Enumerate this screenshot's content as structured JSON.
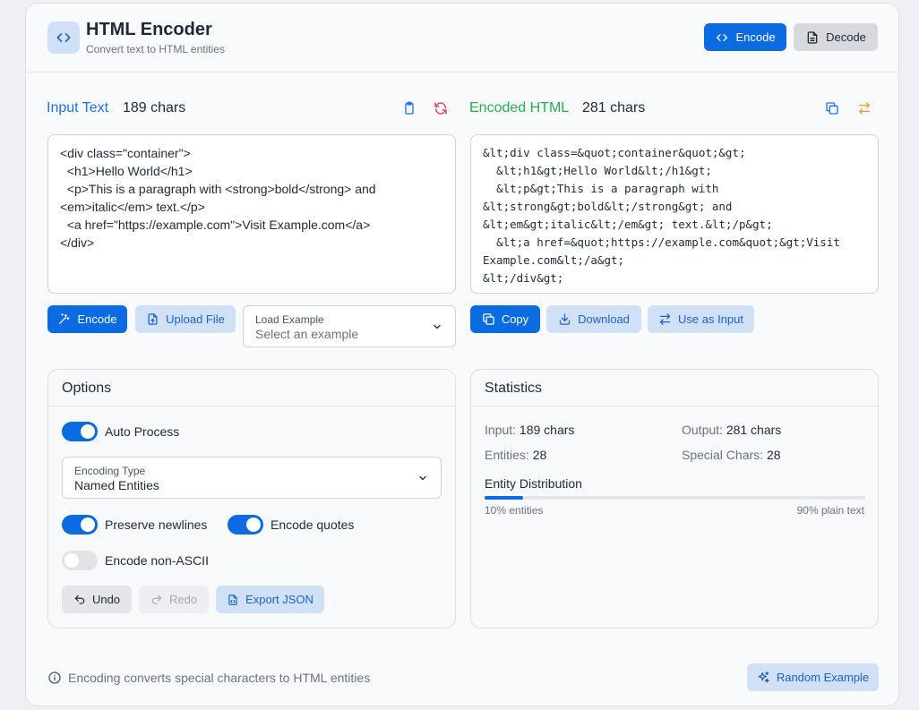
{
  "header": {
    "title": "HTML Encoder",
    "subtitle": "Convert text to HTML entities",
    "encode_label": "Encode",
    "decode_label": "Decode"
  },
  "input": {
    "label": "Input Text",
    "count": "189 chars",
    "text": "<div class=\"container\">\n  <h1>Hello World</h1>\n  <p>This is a paragraph with <strong>bold</strong> and <em>italic</em> text.</p>\n  <a href=\"https://example.com\">Visit Example.com</a>\n</div>",
    "encode_label": "Encode",
    "upload_label": "Upload File",
    "example_select": {
      "label": "Load Example",
      "value": "Select an example"
    }
  },
  "output": {
    "label": "Encoded HTML",
    "count": "281 chars",
    "text": "&lt;div class=&quot;container&quot;&gt;\n  &lt;h1&gt;Hello World&lt;/h1&gt;\n  &lt;p&gt;This is a paragraph with &lt;strong&gt;bold&lt;/strong&gt; and &lt;em&gt;italic&lt;/em&gt; text.&lt;/p&gt;\n  &lt;a href=&quot;https://example.com&quot;&gt;Visit Example.com&lt;/a&gt;\n&lt;/div&gt;",
    "copy_label": "Copy",
    "download_label": "Download",
    "use_label": "Use as Input"
  },
  "options": {
    "title": "Options",
    "auto_process": "Auto Process",
    "encoding_select": {
      "label": "Encoding Type",
      "value": "Named Entities"
    },
    "preserve_newlines": "Preserve newlines",
    "encode_quotes": "Encode quotes",
    "encode_non_ascii": "Encode non-ASCII",
    "undo_label": "Undo",
    "redo_label": "Redo",
    "export_label": "Export JSON"
  },
  "stats": {
    "title": "Statistics",
    "input_label": "Input:",
    "input_value": "189 chars",
    "output_label": "Output:",
    "output_value": "281 chars",
    "entities_label": "Entities:",
    "entities_value": "28",
    "special_label": "Special Chars:",
    "special_value": "28",
    "distribution_title": "Entity Distribution",
    "entities_percent_label": "10% entities",
    "plain_percent_label": "90% plain text",
    "entity_fraction": 0.1
  },
  "footer": {
    "note": "Encoding converts special characters to HTML entities",
    "random_label": "Random Example"
  },
  "colors": {
    "primary": "#0b6be0",
    "green": "#22b24c",
    "orange": "#f0a030",
    "red": "#e5304a"
  }
}
